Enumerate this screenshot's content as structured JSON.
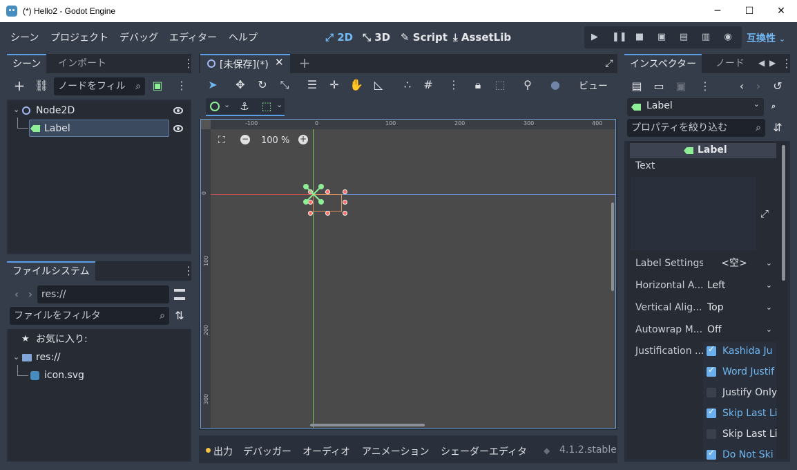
{
  "window": {
    "title": "(*) Hello2 - Godot Engine",
    "minimize": "─",
    "maximize": "☐",
    "close": "✕"
  },
  "menu": [
    "シーン",
    "プロジェクト",
    "デバッグ",
    "エディター",
    "ヘルプ"
  ],
  "modes": [
    "2D",
    "3D",
    "Script",
    "AssetLib"
  ],
  "renderer": "互換性",
  "scene_dock": {
    "tabs": [
      "シーン",
      "インポート"
    ],
    "filter_placeholder": "ノードをフィル",
    "nodes": [
      {
        "name": "Node2D"
      },
      {
        "name": "Label"
      }
    ]
  },
  "filesystem": {
    "tab": "ファイルシステム",
    "path": "res://",
    "filter_placeholder": "ファイルをフィルタ",
    "items": [
      {
        "name": "お気に入り:"
      },
      {
        "name": "res://"
      },
      {
        "name": "icon.svg"
      }
    ]
  },
  "editor": {
    "scene_tab": "[未保存](*)",
    "view_menu": "ビュー",
    "zoom": "100 %",
    "ruler_top": [
      "-100",
      "0",
      "100",
      "200",
      "300",
      "400"
    ],
    "ruler_left": [
      "0",
      "100",
      "200",
      "300"
    ]
  },
  "bottom": {
    "tabs": [
      "出力",
      "デバッガー",
      "オーディオ",
      "アニメーション",
      "シェーダーエディタ"
    ],
    "version": "4.1.2.stable"
  },
  "inspector": {
    "tabs": [
      "インスペクター",
      "ノード"
    ],
    "node_type": "Label",
    "filter_placeholder": "プロパティを絞り込む",
    "section": "Label",
    "text_label": "Text",
    "props": [
      {
        "label": "Label Settings",
        "value": "<空>"
      },
      {
        "label": "Horizontal A...",
        "value": "Left"
      },
      {
        "label": "Vertical Alig...",
        "value": "Top"
      },
      {
        "label": "Autowrap M...",
        "value": "Off"
      }
    ],
    "justification_label": "Justification ...",
    "flags": [
      {
        "label": "Kashida Ju",
        "checked": true
      },
      {
        "label": "Word Justif",
        "checked": true
      },
      {
        "label": "Justify Only",
        "checked": false
      },
      {
        "label": "Skip Last Li",
        "checked": true
      },
      {
        "label": "Skip Last Li",
        "checked": false
      },
      {
        "label": "Do Not Ski",
        "checked": true
      }
    ]
  }
}
